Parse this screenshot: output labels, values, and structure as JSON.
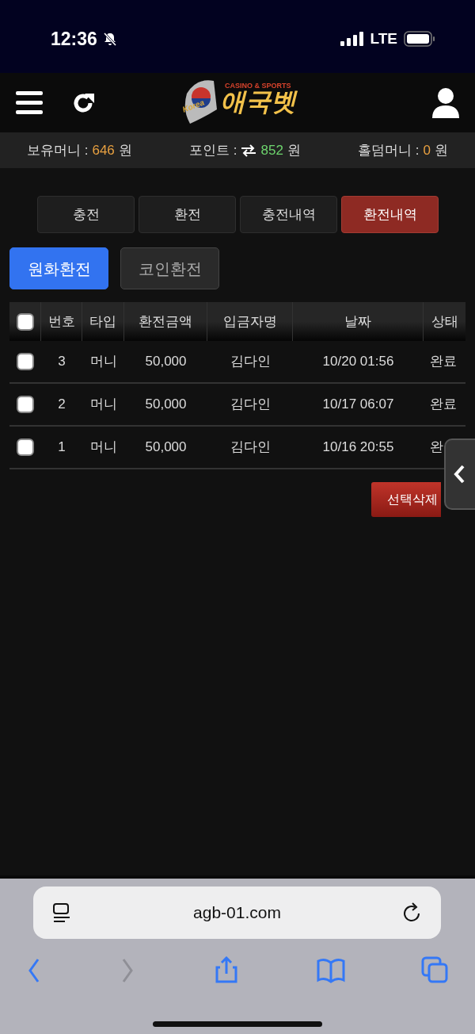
{
  "status_bar": {
    "time": "12:36",
    "silent": true,
    "network": "LTE"
  },
  "header": {
    "logo_flag_text": "Korea",
    "logo_tagline": "CASINO & SPORTS",
    "logo_name": "애국벳"
  },
  "balances": [
    {
      "kind": "plain",
      "label": "보유머니 :",
      "value": "646",
      "unit": "원",
      "color": "#e8a040"
    },
    {
      "kind": "exchange",
      "label": "포인트 :",
      "value": "852",
      "unit": "원",
      "color": "#6dd46d"
    },
    {
      "kind": "plain",
      "label": "홀덤머니 :",
      "value": "0",
      "unit": "원",
      "color": "#e8a040"
    }
  ],
  "tabs": [
    {
      "label": "충전",
      "selected": false
    },
    {
      "label": "환전",
      "selected": false
    },
    {
      "label": "충전내역",
      "selected": false
    },
    {
      "label": "환전내역",
      "selected": true
    }
  ],
  "subtabs": [
    {
      "label": "원화환전",
      "selected": true
    },
    {
      "label": "코인환전",
      "selected": false
    }
  ],
  "table": {
    "select_all_checked": false,
    "columns": [
      "번호",
      "타입",
      "환전금액",
      "입금자명",
      "날짜",
      "상태"
    ],
    "rows": [
      {
        "checked": false,
        "cells": [
          "3",
          "머니",
          "50,000",
          "김다인",
          "10/20 01:56",
          "완료"
        ]
      },
      {
        "checked": false,
        "cells": [
          "2",
          "머니",
          "50,000",
          "김다인",
          "10/17 06:07",
          "완료"
        ]
      },
      {
        "checked": false,
        "cells": [
          "1",
          "머니",
          "50,000",
          "김다인",
          "10/16 20:55",
          "완"
        ]
      }
    ]
  },
  "delete_button": "선택삭제",
  "browser": {
    "url": "agb-01.com",
    "toolbar": [
      {
        "kind": "back",
        "disabled": false
      },
      {
        "kind": "forward",
        "disabled": true
      },
      {
        "kind": "share",
        "disabled": false
      },
      {
        "kind": "bookmarks",
        "disabled": false
      },
      {
        "kind": "tabs",
        "disabled": false
      }
    ]
  }
}
